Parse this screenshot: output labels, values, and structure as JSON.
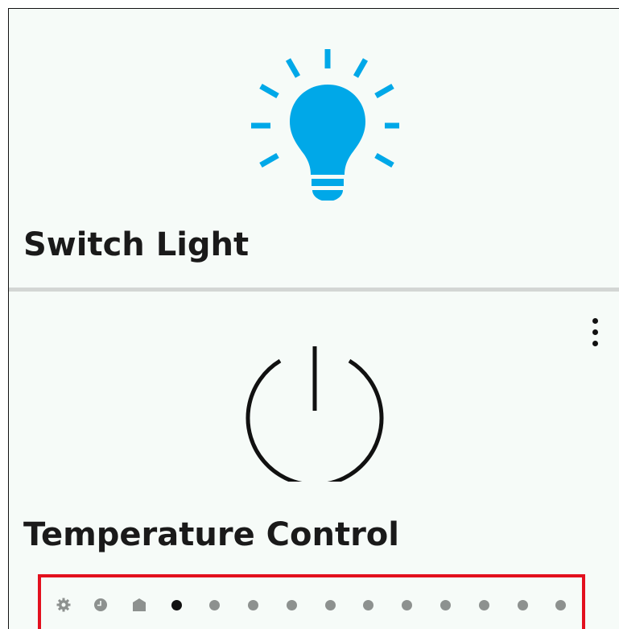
{
  "tiles": [
    {
      "title": "Switch Light",
      "icon": "lightbulb-icon",
      "icon_color": "#00a8e8"
    },
    {
      "title": "Temperature Control",
      "icon": "power-icon",
      "icon_color": "#111111"
    }
  ],
  "menu": {
    "icon": "more-vertical-icon"
  },
  "page_indicator": {
    "items": [
      "settings-icon",
      "clock-icon",
      "home-icon",
      "page-dot",
      "page-dot",
      "page-dot",
      "page-dot",
      "page-dot",
      "page-dot",
      "page-dot",
      "page-dot",
      "page-dot",
      "page-dot",
      "page-dot"
    ],
    "active_index": 3,
    "highlight_color": "#e3101e"
  },
  "colors": {
    "background": "#f6fbf8",
    "divider": "#d3d6d4",
    "inactive": "#8d918f",
    "text": "#1a1a1a"
  }
}
